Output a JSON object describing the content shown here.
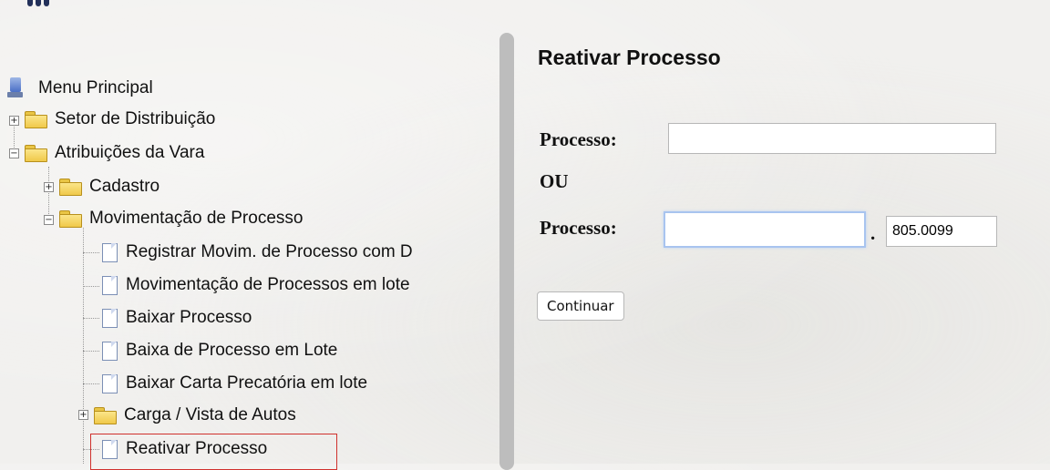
{
  "tree": {
    "root": "Menu Principal",
    "setor": "Setor de Distribuição",
    "atribuicoes": "Atribuições da Vara",
    "cadastro": "Cadastro",
    "movimentacao": "Movimentação de Processo",
    "items": [
      "Registrar Movim. de Processo com D",
      "Movimentação de Processos em lote",
      "Baixar Processo",
      "Baixa de Processo em Lote",
      "Baixar Carta Precatória em lote"
    ],
    "carga": "Carga / Vista de Autos",
    "reativar": "Reativar Processo"
  },
  "form": {
    "title": "Reativar Processo",
    "processo_label": "Processo:",
    "ou_label": "OU",
    "processo_label_2": "Processo:",
    "processo_value": "",
    "processo_number_value": "",
    "suffix_separator": ".",
    "suffix_value": "805.0099",
    "continue_label": "Continuar"
  },
  "colors": {
    "highlight": "#d0312d",
    "focus": "#a8c4ef"
  }
}
